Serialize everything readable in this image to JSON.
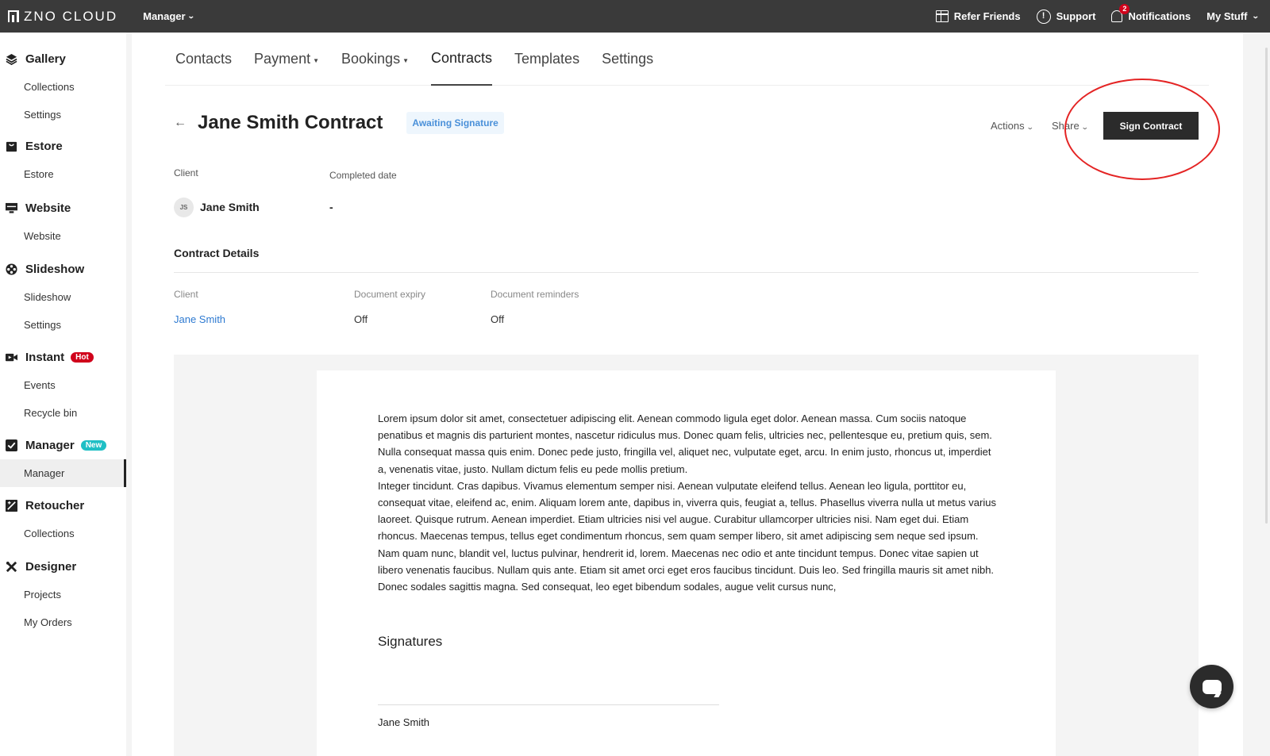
{
  "topbar": {
    "brand": "ZNO CLOUD",
    "product": "Manager",
    "refer": "Refer Friends",
    "support": "Support",
    "notifications": "Notifications",
    "notification_count": "2",
    "my_stuff": "My Stuff"
  },
  "sidebar": {
    "gallery": {
      "label": "Gallery",
      "items": [
        "Collections",
        "Settings"
      ]
    },
    "estore": {
      "label": "Estore",
      "items": [
        "Estore"
      ]
    },
    "website": {
      "label": "Website",
      "items": [
        "Website"
      ]
    },
    "slideshow": {
      "label": "Slideshow",
      "items": [
        "Slideshow",
        "Settings"
      ]
    },
    "instant": {
      "label": "Instant",
      "tag": "Hot",
      "items": [
        "Events",
        "Recycle bin"
      ]
    },
    "manager": {
      "label": "Manager",
      "tag": "New",
      "items": [
        "Manager"
      ]
    },
    "retoucher": {
      "label": "Retoucher",
      "items": [
        "Collections"
      ]
    },
    "designer": {
      "label": "Designer",
      "items": [
        "Projects",
        "My Orders"
      ]
    }
  },
  "tabs": [
    "Contacts",
    "Payment",
    "Bookings",
    "Contracts",
    "Templates",
    "Settings"
  ],
  "header": {
    "back": "←",
    "title": "Jane Smith Contract",
    "status": "Awaiting Signature",
    "actions": "Actions",
    "share": "Share",
    "sign": "Sign Contract"
  },
  "summary": {
    "client_label": "Client",
    "completed_label": "Completed date",
    "avatar_initials": "JS",
    "client_name": "Jane Smith",
    "completed_value": "-"
  },
  "details": {
    "title": "Contract Details",
    "client_label": "Client",
    "client_value": "Jane Smith",
    "expiry_label": "Document expiry",
    "expiry_value": "Off",
    "reminders_label": "Document reminders",
    "reminders_value": "Off"
  },
  "document": {
    "paragraph1": "Lorem ipsum dolor sit amet, consectetuer adipiscing elit. Aenean commodo ligula eget dolor. Aenean massa. Cum sociis natoque penatibus et magnis dis parturient montes, nascetur ridiculus mus. Donec quam felis, ultricies nec, pellentesque eu, pretium quis, sem. Nulla consequat massa quis enim. Donec pede justo, fringilla vel, aliquet nec, vulputate eget, arcu. In enim justo, rhoncus ut, imperdiet a, venenatis vitae, justo. Nullam dictum felis eu pede mollis pretium.",
    "paragraph2": "Integer tincidunt. Cras dapibus. Vivamus elementum semper nisi. Aenean vulputate eleifend tellus. Aenean leo ligula, porttitor eu, consequat vitae, eleifend ac, enim. Aliquam lorem ante, dapibus in, viverra quis, feugiat a, tellus. Phasellus viverra nulla ut metus varius laoreet. Quisque rutrum. Aenean imperdiet. Etiam ultricies nisi vel augue. Curabitur ullamcorper ultricies nisi. Nam eget dui. Etiam rhoncus. Maecenas tempus, tellus eget condimentum rhoncus, sem quam semper libero, sit amet adipiscing sem neque sed ipsum. Nam quam nunc, blandit vel, luctus pulvinar, hendrerit id, lorem. Maecenas nec odio et ante tincidunt tempus. Donec vitae sapien ut libero venenatis faucibus. Nullam quis ante. Etiam sit amet orci eget eros faucibus tincidunt. Duis leo. Sed fringilla mauris sit amet nibh. Donec sodales sagittis magna. Sed consequat, leo eget bibendum sodales, augue velit cursus nunc,",
    "signatures_title": "Signatures",
    "signer": "Jane Smith"
  },
  "colors": {
    "topbar": "#3a3a3a",
    "accent_link": "#2e7ad1",
    "status_text": "#4a90d9",
    "highlight": "#e42424",
    "hot": "#d0021b",
    "new": "#1fbfc5"
  }
}
